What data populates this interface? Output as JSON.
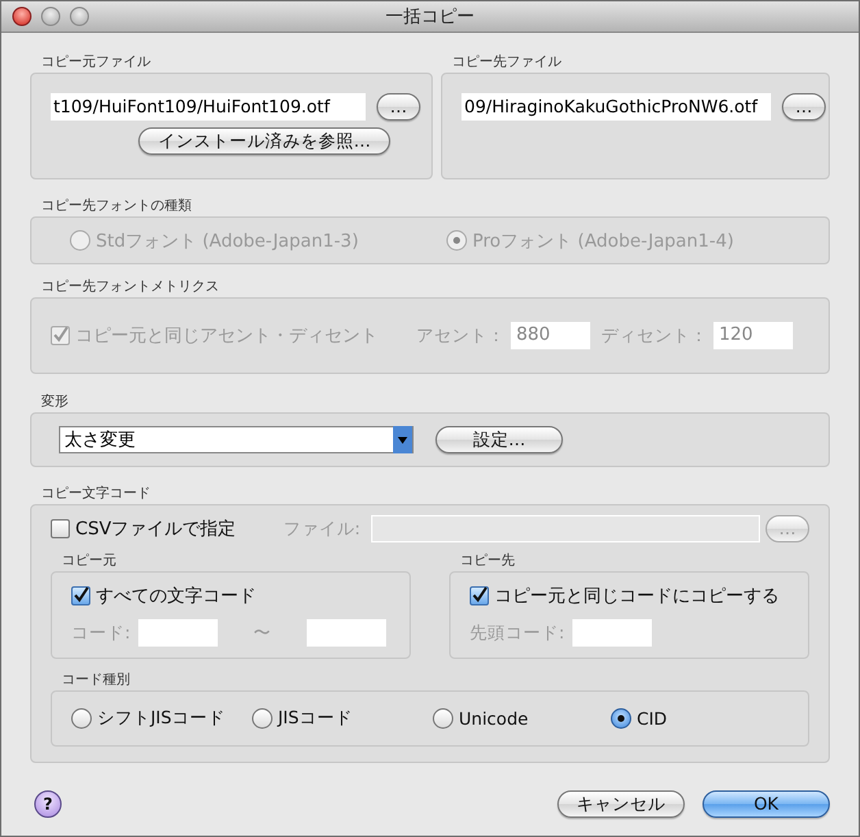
{
  "window": {
    "title": "一括コピー"
  },
  "source_file": {
    "label": "コピー元ファイル",
    "path": "t109/HuiFont109/HuiFont109.otf",
    "browse_button": "…",
    "installed_button": "インストール済みを参照…"
  },
  "dest_file": {
    "label": "コピー先ファイル",
    "path": "09/HiraginoKakuGothicProNW6.otf",
    "browse_button": "…"
  },
  "font_type": {
    "label": "コピー先フォントの種類",
    "disabled": true,
    "options": [
      {
        "label": "Stdフォント (Adobe-Japan1-3)",
        "selected": false
      },
      {
        "label": "Proフォント (Adobe-Japan1-4)",
        "selected": true
      }
    ]
  },
  "metrics": {
    "label": "コピー先フォントメトリクス",
    "disabled": true,
    "same_as_source": {
      "label": "コピー元と同じアセント・ディセント",
      "checked": true
    },
    "ascent": {
      "label": "アセント：",
      "value": "880"
    },
    "descent": {
      "label": "ディセント：",
      "value": "120"
    }
  },
  "transform": {
    "label": "変形",
    "value": "太さ変更",
    "settings_button": "設定…"
  },
  "char_code": {
    "label": "コピー文字コード",
    "csv": {
      "label": "CSVファイルで指定",
      "checked": false
    },
    "file_label": "ファイル:",
    "file_browse": "…",
    "source": {
      "label": "コピー元",
      "all_codes": {
        "label": "すべての文字コード",
        "checked": true
      },
      "code_label": "コード:",
      "range_sep": "〜"
    },
    "dest": {
      "label": "コピー先",
      "same_code": {
        "label": "コピー元と同じコードにコピーする",
        "checked": true
      },
      "start_label": "先頭コード:"
    },
    "code_type": {
      "label": "コード種別",
      "options": [
        {
          "label": "シフトJISコード",
          "selected": false
        },
        {
          "label": "JISコード",
          "selected": false
        },
        {
          "label": "Unicode",
          "selected": false
        },
        {
          "label": "CID",
          "selected": true
        }
      ]
    }
  },
  "help": "?",
  "buttons": [
    {
      "label": "キャンセル",
      "kind": "normal"
    },
    {
      "label": "OK",
      "kind": "default"
    }
  ]
}
